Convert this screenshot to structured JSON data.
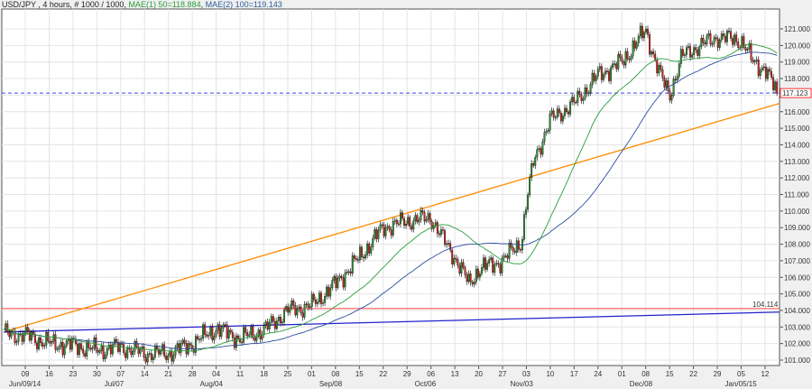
{
  "header": {
    "symbol": "USD/JPY",
    "info": " , 4 hours, # 1000 / 1000, ",
    "ma1": "MAE(1) 50=118.884",
    "ma_sep": ", ",
    "ma2": "MAE(2) 100=119.143"
  },
  "colors": {
    "up": "#2e8b2e",
    "down": "#cc2222",
    "ma1": "#2a9d3a",
    "ma2": "#2b4f9e",
    "trend_orange": "#ff8c00",
    "trend_blue": "#2222cc",
    "hline_red": "#ff4040",
    "hline_blue": "#4444ff"
  },
  "chart_data": {
    "type": "candlestick",
    "title": "USD/JPY , 4 hours",
    "ylim": [
      100.7,
      121.6
    ],
    "y_ticks": [
      "101.000",
      "102.000",
      "103.000",
      "104.000",
      "105.000",
      "106.000",
      "107.000",
      "108.000",
      "109.000",
      "110.000",
      "111.000",
      "112.000",
      "113.000",
      "114.000",
      "115.000",
      "116.000",
      "117.000",
      "118.000",
      "119.000",
      "120.000",
      "121.000"
    ],
    "x_ticks": [
      "09",
      "16",
      "23",
      "30",
      "07",
      "14",
      "21",
      "28",
      "04",
      "11",
      "18",
      "25",
      "01",
      "08",
      "15",
      "22",
      "29",
      "06",
      "13",
      "20",
      "27",
      "03",
      "10",
      "17",
      "24",
      "01",
      "08",
      "15",
      "22",
      "29",
      "05",
      "12"
    ],
    "month_labels": [
      {
        "label": "Jun/09/14",
        "week": 0
      },
      {
        "label": "Jul/07",
        "week": 4
      },
      {
        "label": "Aug/04",
        "week": 8
      },
      {
        "label": "Sep/08",
        "week": 13
      },
      {
        "label": "Oct/06",
        "week": 17
      },
      {
        "label": "Nov/03",
        "week": 21
      },
      {
        "label": "Dec/08",
        "week": 26
      },
      {
        "label": "Jan/05/15",
        "week": 30
      }
    ],
    "weekly_close_approx": [
      [
        -0.9,
        102.6
      ],
      [
        0,
        102.5
      ],
      [
        1,
        102.0
      ],
      [
        2,
        101.9
      ],
      [
        3,
        101.6
      ],
      [
        4,
        101.8
      ],
      [
        5,
        101.4
      ],
      [
        6,
        101.4
      ],
      [
        7,
        102.0
      ],
      [
        8,
        102.9
      ],
      [
        9,
        102.3
      ],
      [
        10,
        102.8
      ],
      [
        11,
        104.0
      ],
      [
        12,
        104.3
      ],
      [
        13,
        105.6
      ],
      [
        14,
        107.2
      ],
      [
        15,
        109.0
      ],
      [
        16,
        109.4
      ],
      [
        17,
        109.6
      ],
      [
        17.5,
        108.3
      ],
      [
        18,
        107.2
      ],
      [
        18.6,
        105.6
      ],
      [
        19,
        106.5
      ],
      [
        20,
        107.0
      ],
      [
        20.8,
        108.2
      ],
      [
        21,
        110.5
      ],
      [
        21.3,
        113.0
      ],
      [
        22,
        115.5
      ],
      [
        23,
        116.5
      ],
      [
        24,
        118.2
      ],
      [
        25,
        119.0
      ],
      [
        26,
        120.9
      ],
      [
        26.6,
        118.2
      ],
      [
        27,
        117.0
      ],
      [
        27.5,
        119.3
      ],
      [
        28,
        119.8
      ],
      [
        29,
        120.5
      ],
      [
        30,
        120.3
      ],
      [
        30.5,
        119.0
      ],
      [
        31,
        118.6
      ],
      [
        31.5,
        117.1
      ]
    ],
    "last_price": "117.123",
    "horizontal_levels": [
      {
        "value": 117.123,
        "label": "117.123",
        "style": "dashed-blue"
      },
      {
        "value": 104.114,
        "label": "104.114",
        "style": "solid-red"
      }
    ],
    "trend_lines": [
      {
        "name": "orange-trendline",
        "from": [
          -0.9,
          102.7
        ],
        "to": [
          31.6,
          116.5
        ]
      },
      {
        "name": "blue-trendline",
        "from": [
          -0.9,
          102.7
        ],
        "to": [
          31.6,
          103.9
        ]
      }
    ],
    "moving_averages": [
      {
        "name": "MAE(1) 50",
        "value": 118.884
      },
      {
        "name": "MAE(2) 100",
        "value": 119.143
      }
    ]
  }
}
